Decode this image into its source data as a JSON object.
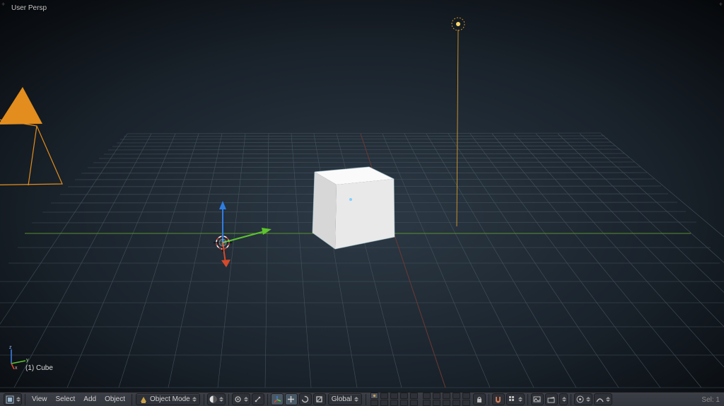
{
  "viewport": {
    "projection_label": "User Persp",
    "object_label": "(1) Cube"
  },
  "axis_letters": {
    "x": "x",
    "y": "y",
    "z": "z"
  },
  "toolbar": {
    "view": "View",
    "select": "Select",
    "add": "Add",
    "object": "Object",
    "mode": "Object Mode",
    "orientation": "Global"
  },
  "status": {
    "selection": "Sel: 1"
  }
}
